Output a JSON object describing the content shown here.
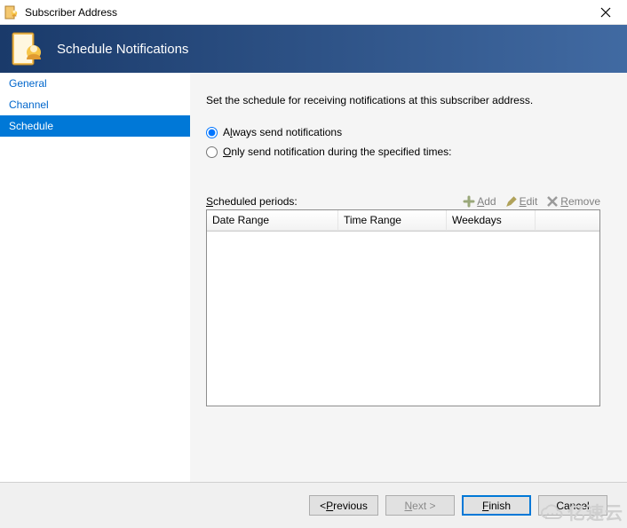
{
  "window": {
    "title": "Subscriber Address"
  },
  "banner": {
    "title": "Schedule Notifications"
  },
  "sidebar": {
    "items": [
      {
        "label": "General",
        "selected": false
      },
      {
        "label": "Channel",
        "selected": false
      },
      {
        "label": "Schedule",
        "selected": true
      }
    ]
  },
  "content": {
    "description": "Set the schedule for receiving notifications at this subscriber address.",
    "radios": {
      "always": {
        "label": "Always send notifications",
        "accel": "l",
        "checked": true
      },
      "only": {
        "label": "Only send notification during the specified times:",
        "accel": "O",
        "checked": false
      }
    },
    "scheduled_periods_label": "Scheduled periods:",
    "scheduled_periods_accel": "S",
    "toolbar": {
      "add": {
        "label": "Add",
        "accel": "A",
        "icon": "plus-icon",
        "enabled": false
      },
      "edit": {
        "label": "Edit",
        "accel": "E",
        "icon": "pencil-icon",
        "enabled": false
      },
      "remove": {
        "label": "Remove",
        "accel": "R",
        "icon": "x-icon",
        "enabled": false
      }
    },
    "grid": {
      "columns": [
        "Date Range",
        "Time Range",
        "Weekdays"
      ],
      "rows": []
    }
  },
  "footer": {
    "previous": {
      "label": "Previous",
      "accel": "P",
      "prefix": "< "
    },
    "next": {
      "label": "Next",
      "accel": "N",
      "suffix": " >",
      "enabled": false
    },
    "finish": {
      "label": "Finish",
      "accel": "F",
      "primary": true
    },
    "cancel": {
      "label": "Cancel"
    }
  },
  "watermark": "亿速云"
}
